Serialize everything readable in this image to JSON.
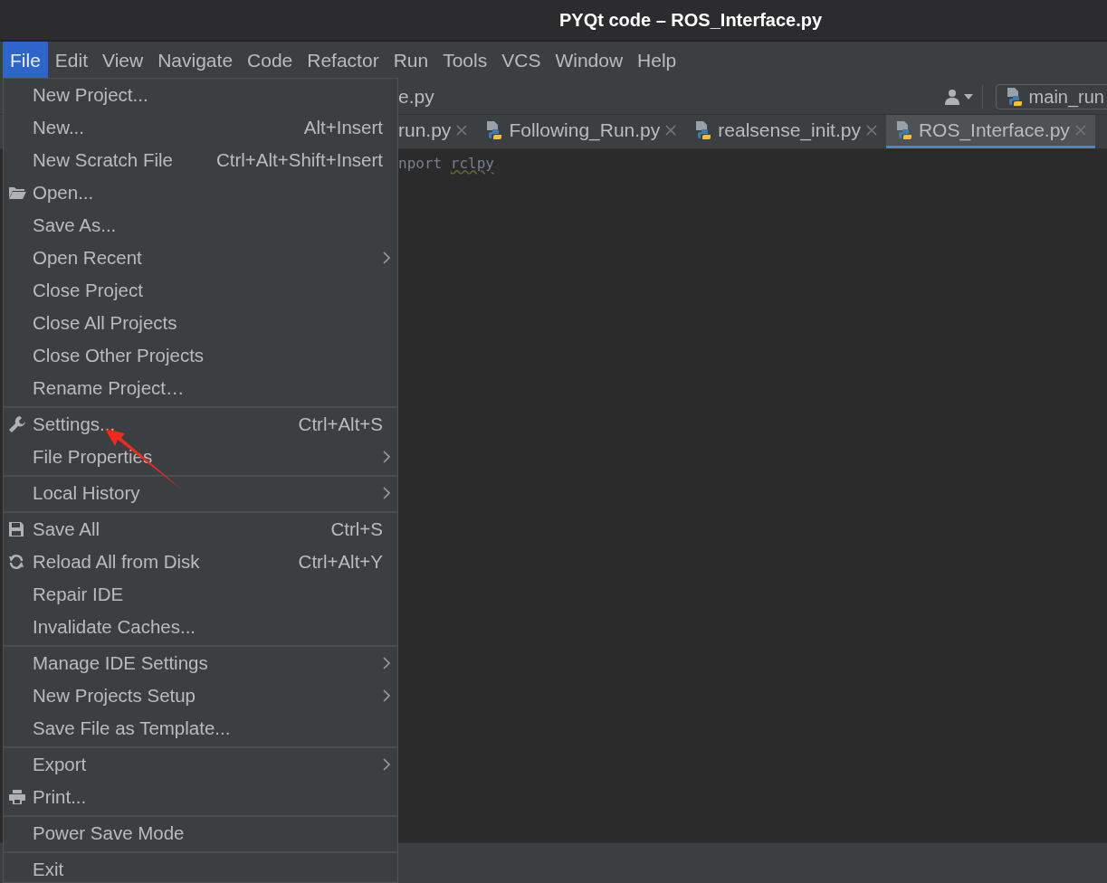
{
  "window": {
    "title": "PYQt code – ROS_Interface.py"
  },
  "menubar": [
    {
      "label": "File",
      "selected": true
    },
    {
      "label": "Edit",
      "selected": false
    },
    {
      "label": "View",
      "selected": false
    },
    {
      "label": "Navigate",
      "selected": false
    },
    {
      "label": "Code",
      "selected": false
    },
    {
      "label": "Refactor",
      "selected": false
    },
    {
      "label": "Run",
      "selected": false
    },
    {
      "label": "Tools",
      "selected": false
    },
    {
      "label": "VCS",
      "selected": false
    },
    {
      "label": "Window",
      "selected": false
    },
    {
      "label": "Help",
      "selected": false
    }
  ],
  "toolbar": {
    "breadcrumb": "e.py",
    "run_configuration": "main_run"
  },
  "tabs": [
    {
      "label": "run.py",
      "selected": false,
      "icon": false
    },
    {
      "label": "Following_Run.py",
      "selected": false,
      "icon": true
    },
    {
      "label": "realsense_init.py",
      "selected": false,
      "icon": true
    },
    {
      "label": "ROS_Interface.py",
      "selected": true,
      "icon": true
    }
  ],
  "editor": {
    "lines": [
      [
        {
          "text": "nport",
          "warning": false
        },
        {
          "text": "rclpy",
          "warning": true
        }
      ]
    ]
  },
  "file_menu": {
    "groups": [
      [
        {
          "label": "New Project..."
        },
        {
          "label": "New...",
          "shortcut": "Alt+Insert"
        },
        {
          "label": "New Scratch File",
          "shortcut": "Ctrl+Alt+Shift+Insert"
        },
        {
          "label": "Open..."
        },
        {
          "label": "Save As..."
        },
        {
          "label": "Open Recent",
          "submenu": true
        },
        {
          "label": "Close Project"
        },
        {
          "label": "Close All Projects"
        },
        {
          "label": "Close Other Projects"
        },
        {
          "label": "Rename Project…"
        }
      ],
      [
        {
          "label": "Settings...",
          "shortcut": "Ctrl+Alt+S"
        },
        {
          "label": "File Properties",
          "submenu": true
        }
      ],
      [
        {
          "label": "Local History",
          "submenu": true
        }
      ],
      [
        {
          "label": "Save All",
          "shortcut": "Ctrl+S"
        },
        {
          "label": "Reload All from Disk",
          "shortcut": "Ctrl+Alt+Y"
        },
        {
          "label": "Repair IDE"
        },
        {
          "label": "Invalidate Caches..."
        }
      ],
      [
        {
          "label": "Manage IDE Settings",
          "submenu": true
        },
        {
          "label": "New Projects Setup",
          "submenu": true
        },
        {
          "label": "Save File as Template..."
        }
      ],
      [
        {
          "label": "Export",
          "submenu": true
        },
        {
          "label": "Print..."
        }
      ],
      [
        {
          "label": "Power Save Mode"
        }
      ],
      [
        {
          "label": "Exit"
        }
      ]
    ]
  }
}
